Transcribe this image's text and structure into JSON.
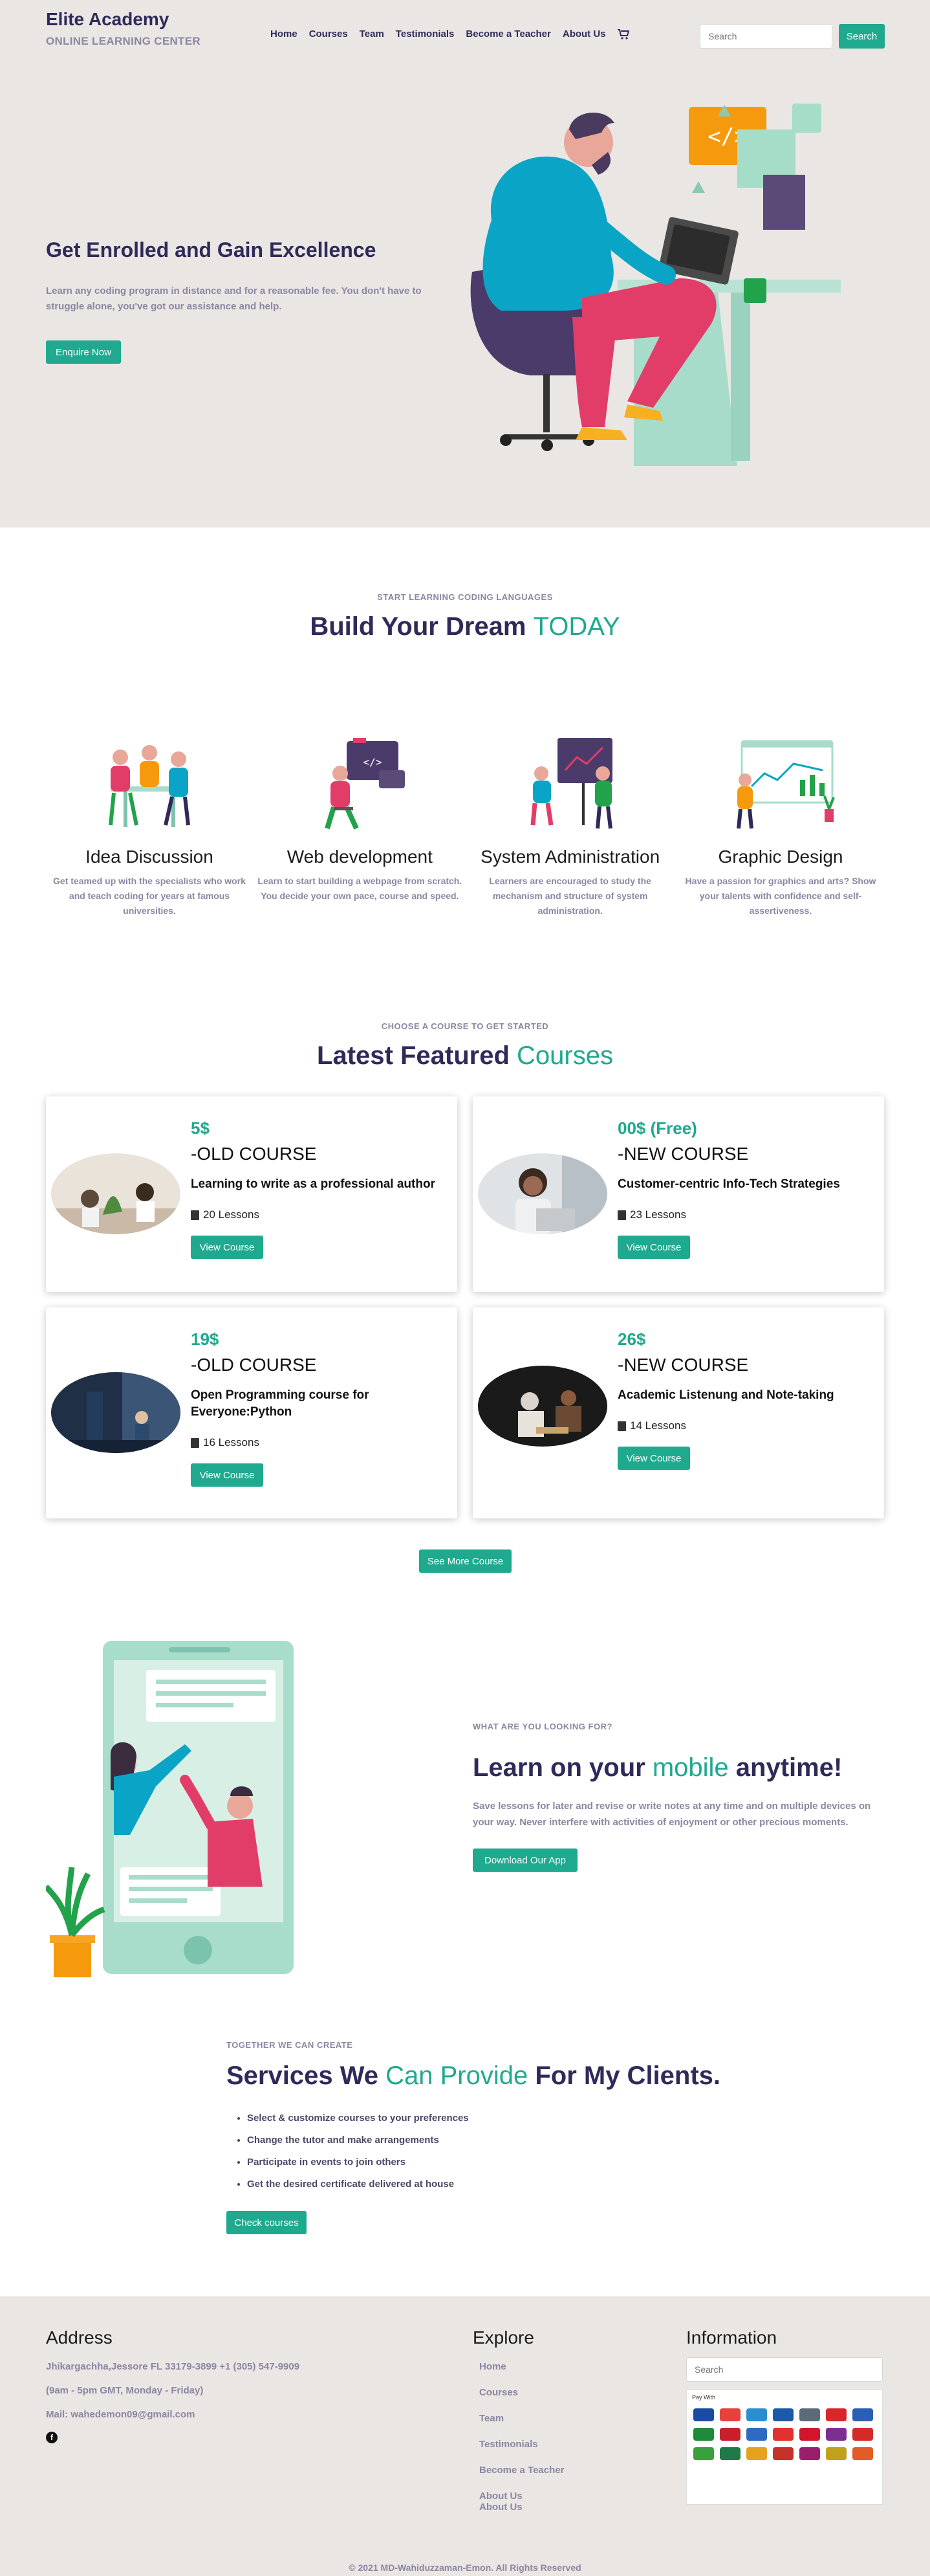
{
  "brand": {
    "title": "Elite Academy",
    "subtitle": "ONLINE LEARNING CENTER"
  },
  "nav": {
    "items": [
      "Home",
      "Courses",
      "Team",
      "Testimonials",
      "Become a Teacher",
      "About Us"
    ],
    "cart_icon": "cart-icon"
  },
  "search": {
    "placeholder": "Search",
    "button": "Search"
  },
  "hero": {
    "title": "Get Enrolled and Gain Excellence",
    "text": "Learn any coding program in distance and for a reasonable fee. You don't have to struggle alone, you've got our assistance and help.",
    "button": "Enquire Now"
  },
  "learn": {
    "eyebrow": "START LEARNING CODING LANGUAGES",
    "title_main": "Build Your Dream ",
    "title_accent": "TODAY",
    "features": [
      {
        "title": "Idea Discussion",
        "text": "Get teamed up with the specialists who work and teach coding for years at famous universities."
      },
      {
        "title": "Web development",
        "text": "Learn to start building a webpage from scratch. You decide your own pace, course and speed."
      },
      {
        "title": "System Administration",
        "text": "Learners are encouraged to study the mechanism and structure of system administration."
      },
      {
        "title": "Graphic Design",
        "text": "Have a passion for graphics and arts? Show your talents with confidence and self-assertiveness."
      }
    ]
  },
  "courses": {
    "eyebrow": "CHOOSE A COURSE TO GET STARTED",
    "title_main": "Latest Featured ",
    "title_accent": "Courses",
    "items": [
      {
        "price": "5$",
        "kind": "-OLD COURSE",
        "title": "Learning to write as a professional author",
        "lessons": "20 Lessons",
        "button": "View Course"
      },
      {
        "price": "00$ (Free)",
        "kind": "-NEW COURSE",
        "title": "Customer-centric Info-Tech Strategies",
        "lessons": "23 Lessons",
        "button": "View Course"
      },
      {
        "price": "19$",
        "kind": "-OLD COURSE",
        "title": "Open Programming course for Everyone:Python",
        "lessons": "16 Lessons",
        "button": "View Course"
      },
      {
        "price": "26$",
        "kind": "-NEW COURSE",
        "title": "Academic Listenung and Note-taking",
        "lessons": "14 Lessons",
        "button": "View Course"
      }
    ],
    "see_more": "See More Course"
  },
  "app": {
    "eyebrow": "WHAT ARE YOU LOOKING FOR?",
    "title_a": "Learn on your ",
    "title_accent": "mobile",
    "title_b": " anytime!",
    "text": "Save lessons for later and revise or write notes at any time and on multiple devices on your way. Never interfere with activities of enjoyment or other precious moments.",
    "button": "Download Our App"
  },
  "services": {
    "eyebrow": "TOGETHER WE CAN CREATE",
    "title_a": "Services We ",
    "title_accent": "Can Provide",
    "title_b": " For My Clients.",
    "items": [
      "Select & customize courses to your preferences",
      "Change the tutor and make arrangements",
      "Participate in events to join others",
      "Get the desired certificate delivered at house"
    ],
    "button": "Check courses"
  },
  "footer": {
    "address_heading": "Address",
    "address_line": "Jhikargachha,Jessore FL 33179-3899 +1 (305) 547-9909",
    "hours": "(9am - 5pm GMT, Monday - Friday)",
    "mail": "Mail: wahedemon09@gmail.com",
    "explore_heading": "Explore",
    "explore_items": [
      "Home",
      "Courses",
      "Team",
      "Testimonials",
      "Become a Teacher",
      "About Us",
      "About Us"
    ],
    "info_heading": "Information",
    "info_placeholder": "Search",
    "pay_label": "Pay With",
    "copyright": "© 2021 MD-Wahiduzzaman-Emon. All Rights Reserved"
  },
  "colors": {
    "accent": "#1fa98e",
    "navy": "#2f2a5a",
    "muted": "#8a86a3",
    "hero_bg": "#eae6e3"
  }
}
